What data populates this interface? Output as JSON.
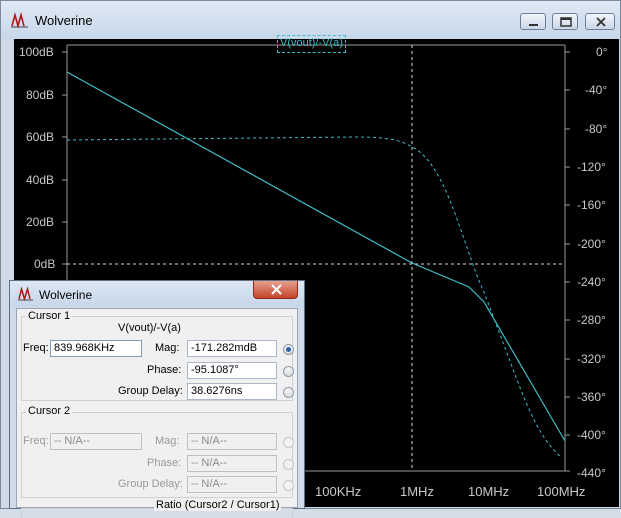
{
  "window": {
    "title": "Wolverine",
    "trace_label": "V(vout)/-V(a)"
  },
  "plot": {
    "left_axis_labels": [
      "100dB",
      "80dB",
      "60dB",
      "40dB",
      "20dB",
      "0dB"
    ],
    "right_axis_labels": [
      "0°",
      "-40°",
      "-80°",
      "-120°",
      "-160°",
      "-200°",
      "-240°",
      "-280°",
      "-320°",
      "-360°",
      "-400°",
      "-440°"
    ],
    "x_axis_labels": [
      "100KHz",
      "1MHz",
      "10MHz",
      "100MHz"
    ],
    "trace_color": "#3fbcc8"
  },
  "cursor_dialog": {
    "title": "Wolverine",
    "cursor1": {
      "group_label": "Cursor 1",
      "expression": "V(vout)/-V(a)",
      "freq_label": "Freq:",
      "freq_value": "839.968KHz",
      "mag_label": "Mag:",
      "mag_value": "-171.282mdB",
      "phase_label": "Phase:",
      "phase_value": "-95.1087°",
      "gd_label": "Group Delay:",
      "gd_value": "38.6276ns"
    },
    "cursor2": {
      "group_label": "Cursor 2",
      "freq_label": "Freq:",
      "freq_value": "-- N/A--",
      "mag_label": "Mag:",
      "mag_value": "-- N/A--",
      "phase_label": "Phase:",
      "phase_value": "-- N/A--",
      "gd_label": "Group Delay:",
      "gd_value": "-- N/A--"
    },
    "ratio_label": "Ratio (Cursor2 / Cursor1)"
  }
}
